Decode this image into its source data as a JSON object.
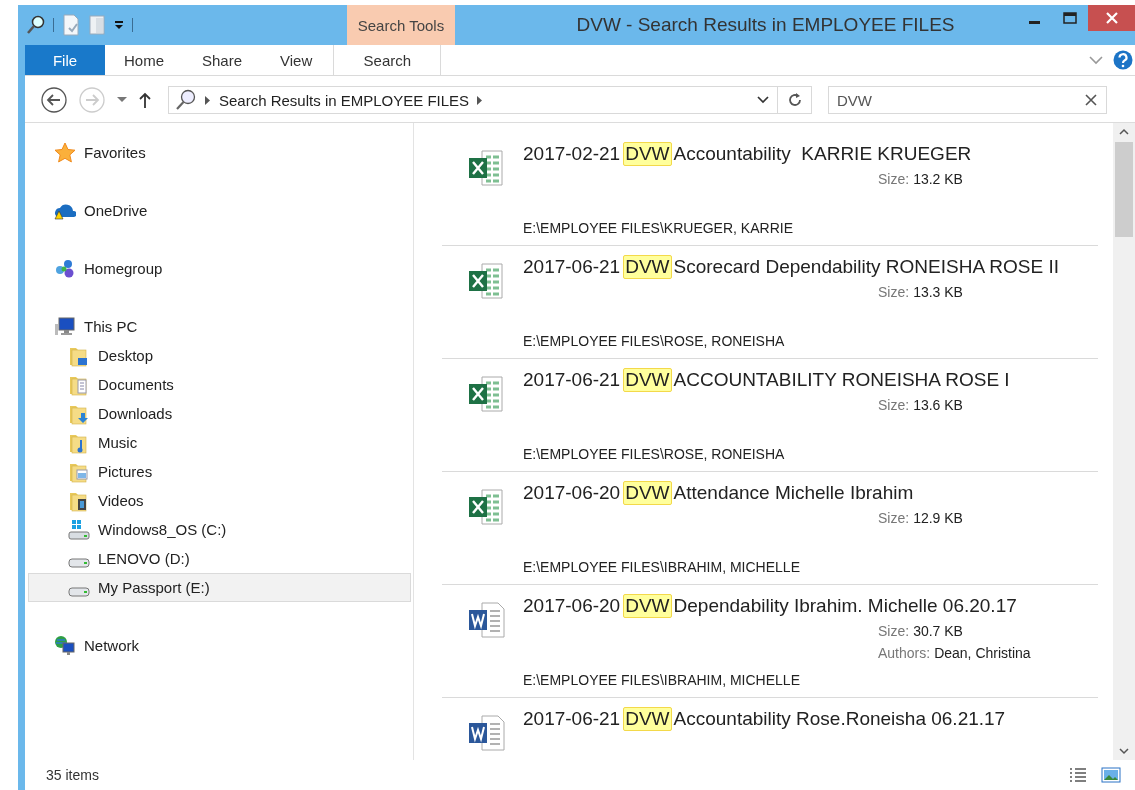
{
  "window": {
    "title": "DVW - Search Results in EMPLOYEE FILES",
    "context_group": "Search Tools"
  },
  "ribbon": {
    "tabs": [
      {
        "label": "File",
        "kind": "file",
        "selected": false
      },
      {
        "label": "Home",
        "kind": "plain",
        "selected": false
      },
      {
        "label": "Share",
        "kind": "plain",
        "selected": false
      },
      {
        "label": "View",
        "kind": "plain",
        "selected": false
      },
      {
        "label": "Search",
        "kind": "context",
        "selected": false
      }
    ]
  },
  "address": {
    "path": "Search Results in EMPLOYEE FILES"
  },
  "search": {
    "value": "DVW"
  },
  "navigation": [
    {
      "label": "Favorites",
      "selected": false
    },
    {
      "label": "OneDrive",
      "selected": false
    },
    {
      "label": "Homegroup",
      "selected": false
    },
    {
      "label": "This PC",
      "selected": false,
      "children": [
        {
          "label": "Desktop",
          "selected": false
        },
        {
          "label": "Documents",
          "selected": false
        },
        {
          "label": "Downloads",
          "selected": false
        },
        {
          "label": "Music",
          "selected": false
        },
        {
          "label": "Pictures",
          "selected": false
        },
        {
          "label": "Videos",
          "selected": false
        },
        {
          "label": "Windows8_OS (C:)",
          "selected": false
        },
        {
          "label": "LENOVO (D:)",
          "selected": false
        },
        {
          "label": "My Passport (E:)",
          "selected": true
        }
      ]
    },
    {
      "label": "Network",
      "selected": false
    }
  ],
  "results": [
    {
      "kind": "excel",
      "date": "2017-02-21",
      "match": "DVW",
      "rest": "Accountability  KARRIE KRUEGER",
      "details": [
        {
          "label": "Size:",
          "value": "13.2 KB"
        }
      ],
      "folder": "E:\\EMPLOYEE FILES\\KRUEGER, KARRIE"
    },
    {
      "kind": "excel",
      "date": "2017-06-21",
      "match": "DVW",
      "rest": "Scorecard Dependability RONEISHA ROSE II",
      "details": [
        {
          "label": "Size:",
          "value": "13.3 KB"
        }
      ],
      "folder": "E:\\EMPLOYEE FILES\\ROSE, RONEISHA"
    },
    {
      "kind": "excel",
      "date": "2017-06-21",
      "match": "DVW",
      "rest": "ACCOUNTABILITY RONEISHA ROSE I",
      "details": [
        {
          "label": "Size:",
          "value": "13.6 KB"
        }
      ],
      "folder": "E:\\EMPLOYEE FILES\\ROSE, RONEISHA"
    },
    {
      "kind": "excel",
      "date": "2017-06-20",
      "match": "DVW",
      "rest": "Attendance Michelle Ibrahim",
      "details": [
        {
          "label": "Size:",
          "value": "12.9 KB"
        }
      ],
      "folder": "E:\\EMPLOYEE FILES\\IBRAHIM, MICHELLE"
    },
    {
      "kind": "word",
      "date": "2017-06-20",
      "match": "DVW",
      "rest": "Dependability Ibrahim. Michelle 06.20.17",
      "details": [
        {
          "label": "Size:",
          "value": "30.7 KB"
        },
        {
          "label": "Authors:",
          "value": "Dean, Christina"
        }
      ],
      "folder": "E:\\EMPLOYEE FILES\\IBRAHIM, MICHELLE"
    },
    {
      "kind": "word",
      "date": "2017-06-21",
      "match": "DVW",
      "rest": "Accountability Rose.Roneisha 06.21.17"
    }
  ],
  "status_bar": {
    "item_count": "35 items"
  }
}
